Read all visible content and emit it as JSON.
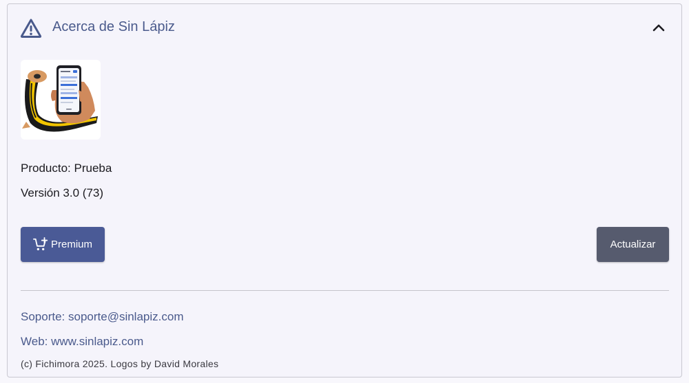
{
  "header": {
    "title": "Acerca de Sin Lápiz",
    "icon": "warning-triangle-icon",
    "collapse_icon": "chevron-up-icon"
  },
  "product": {
    "label": "Producto: Prueba",
    "version": "Versión 3.0 (73)"
  },
  "actions": {
    "premium_label": "Premium",
    "update_label": "Actualizar"
  },
  "links": {
    "support": "Soporte: soporte@sinlapiz.com",
    "web": "Web: www.sinlapiz.com"
  },
  "footer": {
    "copyright": "(c) Fichimora 2025. Logos by David Morales"
  },
  "colors": {
    "accent": "#4a5a96",
    "secondary_button": "#565b6e",
    "link_text": "#4a5a8c",
    "background": "#f5f4fb"
  }
}
